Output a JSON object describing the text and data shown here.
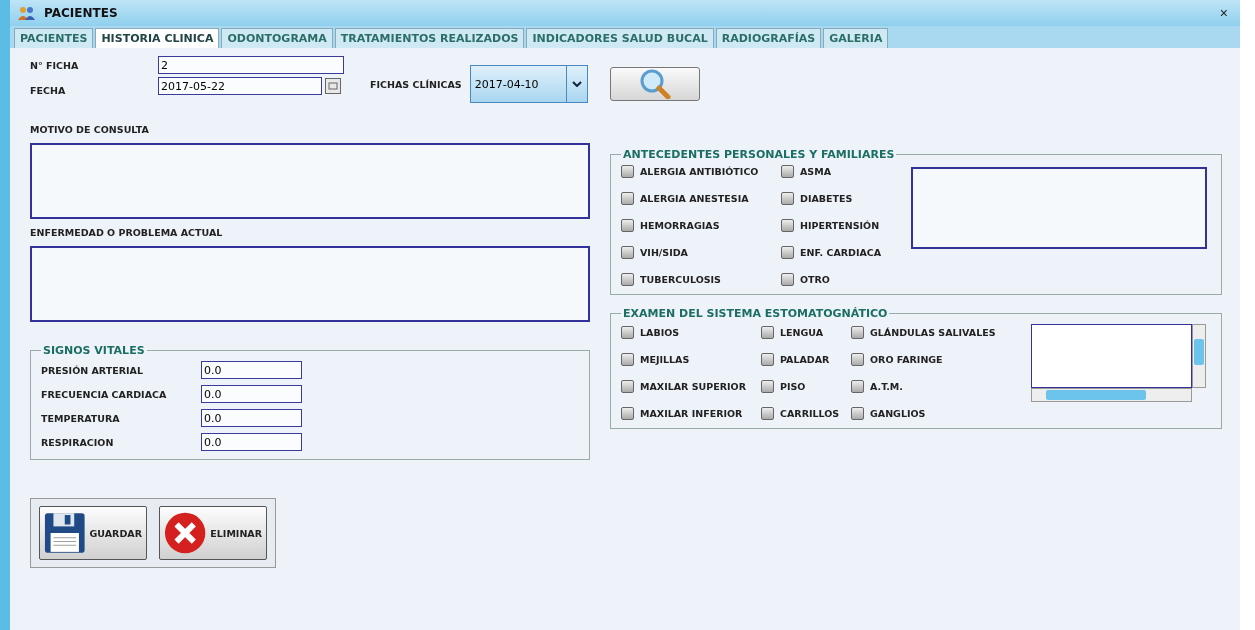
{
  "window": {
    "title": "PACIENTES",
    "close": "×"
  },
  "tabs": [
    {
      "label": "PACIENTES",
      "selected": false
    },
    {
      "label": "HISTORIA CLINICA",
      "selected": true
    },
    {
      "label": "ODONTOGRAMA",
      "selected": false
    },
    {
      "label": "TRATAMIENTOS REALIZADOS",
      "selected": false
    },
    {
      "label": "INDICADORES SALUD BUCAL",
      "selected": false
    },
    {
      "label": "RADIOGRAFÍAS",
      "selected": false
    },
    {
      "label": "GALERIA",
      "selected": false
    }
  ],
  "ficha": {
    "label": "N° FICHA",
    "value": "2"
  },
  "fecha": {
    "label": "FECHA",
    "value": "2017-05-22"
  },
  "fichas_clinicas": {
    "label": "FICHAS CLÍNICAS",
    "value": "2017-04-10"
  },
  "motivo": {
    "label": "MOTIVO DE CONSULTA"
  },
  "enfermedad": {
    "label": "ENFERMEDAD O PROBLEMA ACTUAL"
  },
  "signos_vitales": {
    "title": "SIGNOS VITALES",
    "fields": [
      {
        "label": "PRESIÓN ARTERIAL",
        "value": "0.0"
      },
      {
        "label": "FRECUENCIA CARDIACA",
        "value": "0.0"
      },
      {
        "label": "TEMPERATURA",
        "value": "0.0"
      },
      {
        "label": "RESPIRACION",
        "value": "0.0"
      }
    ]
  },
  "antecedentes": {
    "title": "ANTECEDENTES PERSONALES Y FAMILIARES",
    "items": [
      {
        "label": "ALERGIA ANTIBIÓTICO",
        "checked": false
      },
      {
        "label": "ASMA",
        "checked": false
      },
      {
        "label": "ALERGIA ANESTESIA",
        "checked": false
      },
      {
        "label": "DIABETES",
        "checked": false
      },
      {
        "label": "HEMORRAGIAS",
        "checked": false
      },
      {
        "label": "HIPERTENSIÓN",
        "checked": false
      },
      {
        "label": "VIH/SIDA",
        "checked": false
      },
      {
        "label": "ENF. CARDIACA",
        "checked": false
      },
      {
        "label": "TUBERCULOSIS",
        "checked": false
      },
      {
        "label": "OTRO",
        "checked": false
      }
    ]
  },
  "examen": {
    "title": "EXAMEN DEL SISTEMA ESTOMATOGNÁTICO",
    "items": [
      {
        "label": "LABIOS",
        "checked": false
      },
      {
        "label": "LENGUA",
        "checked": false
      },
      {
        "label": "GLÁNDULAS SALIVALES",
        "checked": false
      },
      {
        "label": "MEJILLAS",
        "checked": false
      },
      {
        "label": "PALADAR",
        "checked": false
      },
      {
        "label": "ORO FARINGE",
        "checked": false
      },
      {
        "label": "MAXILAR SUPERIOR",
        "checked": false
      },
      {
        "label": "PISO",
        "checked": false
      },
      {
        "label": "A.T.M.",
        "checked": false
      },
      {
        "label": "MAXILAR INFERIOR",
        "checked": false
      },
      {
        "label": "CARRILLOS",
        "checked": false
      },
      {
        "label": "GANGLIOS",
        "checked": false
      }
    ]
  },
  "buttons": [
    {
      "label": "GUARDAR",
      "kind": "save"
    },
    {
      "label": "ELIMINAR",
      "kind": "delete"
    }
  ]
}
